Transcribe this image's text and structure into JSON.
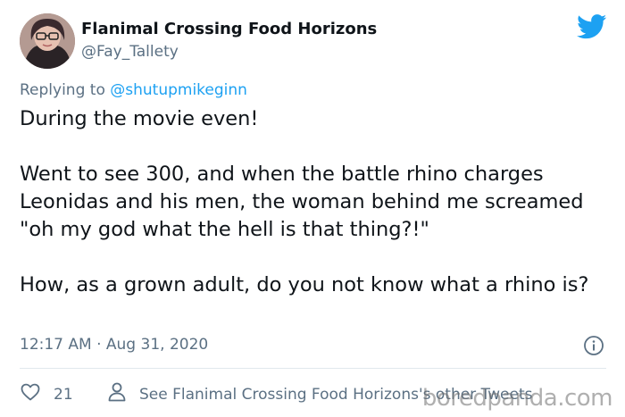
{
  "tweet": {
    "author_name": "Flanimal Crossing Food Horizons",
    "author_handle": "@Fay_Tallety",
    "reply_prefix": "Replying to ",
    "reply_to": "@shutupmikeginn",
    "paragraphs": [
      "During the movie even!",
      "Went to see 300, and when the battle rhino charges Leonidas and his men, the woman behind me screamed \"oh my god what the hell is that thing?!\"",
      "How, as a grown adult, do you not know what a rhino is?"
    ],
    "timestamp": "12:17 AM · Aug 31, 2020",
    "like_count": "21",
    "see_more_label": "See Flanimal Crossing Food Horizons's other Tweets"
  },
  "watermark": "boredpanda.com",
  "colors": {
    "twitter_blue": "#1da1f2",
    "secondary_text": "#5b7083",
    "primary_text": "#0f1419"
  },
  "icons": [
    "avatar",
    "twitter-bird-icon",
    "info-icon",
    "heart-icon",
    "person-icon"
  ]
}
